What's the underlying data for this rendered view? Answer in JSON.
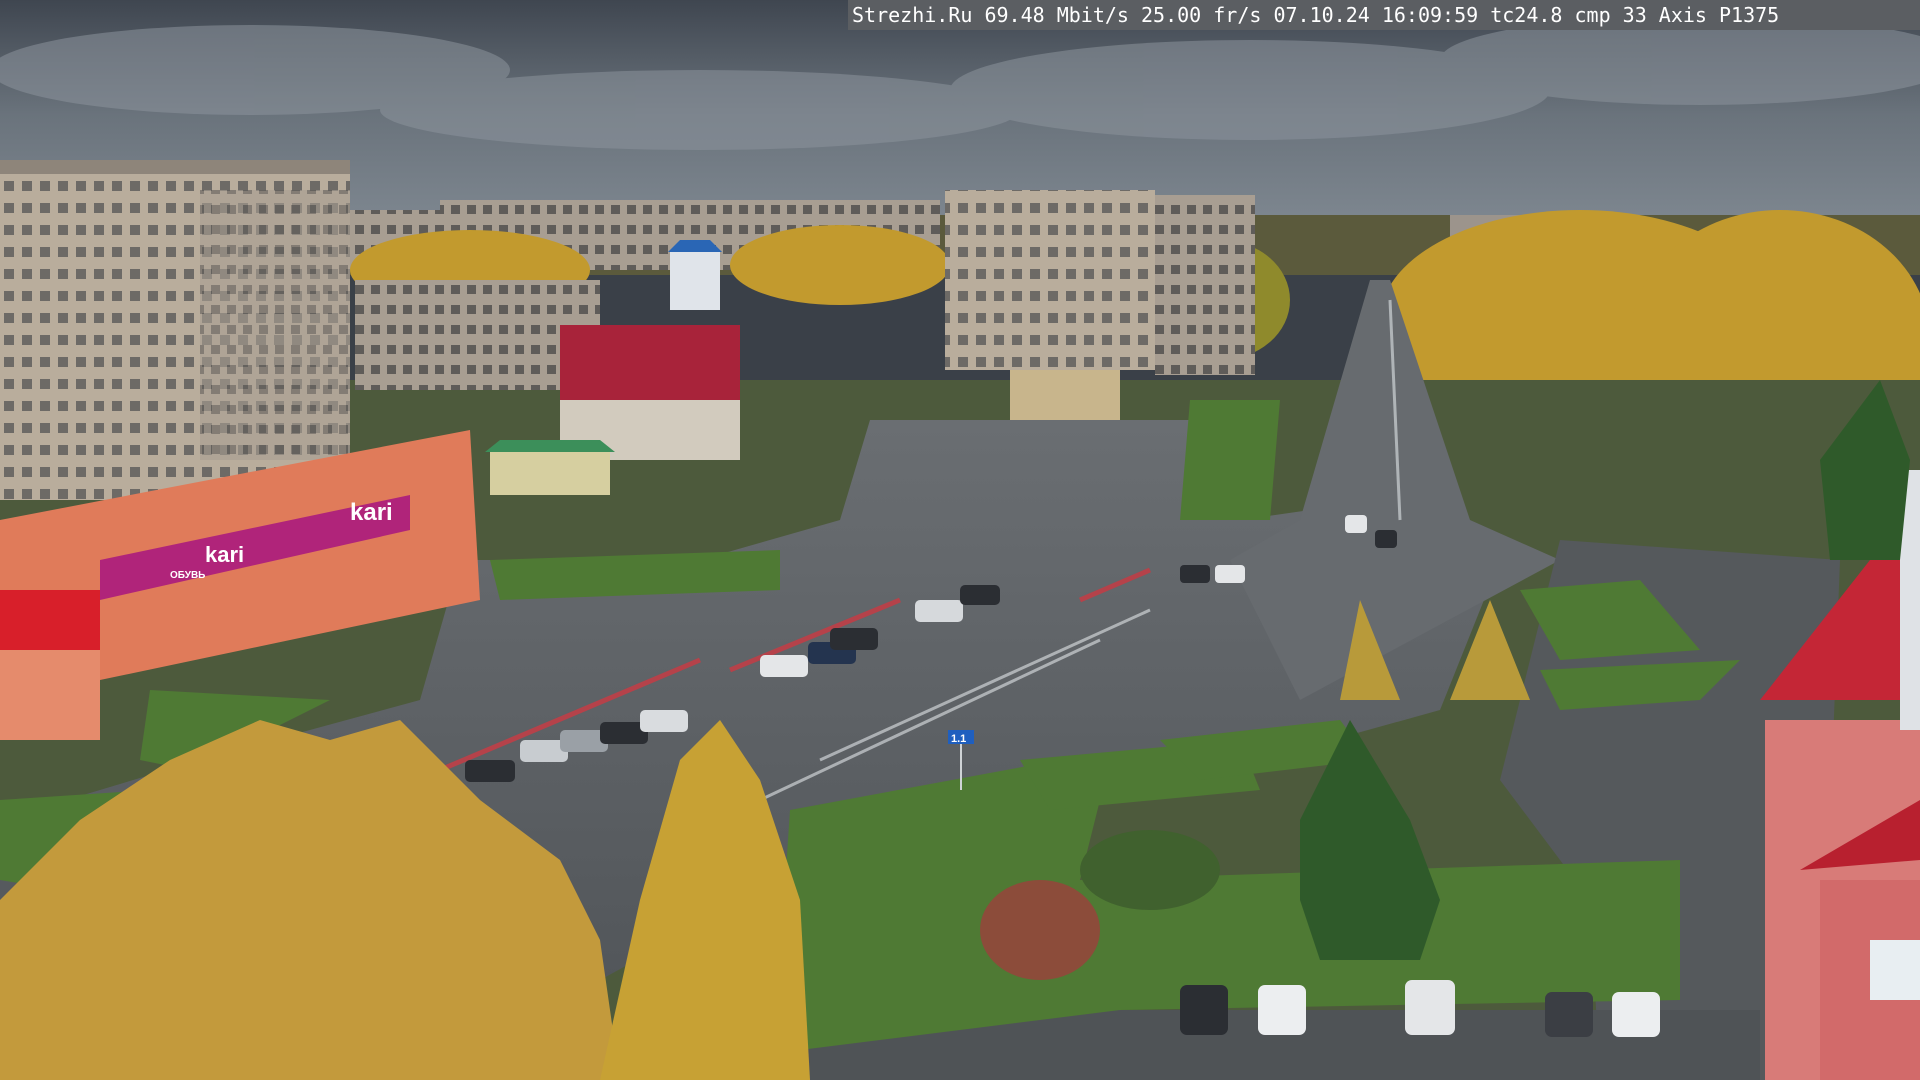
{
  "osd": {
    "site": "Strezhi.Ru",
    "bitrate": "69.48 Mbit/s",
    "framerate": "25.00 fr/s",
    "date": "07.10.24",
    "time": "16:09:59",
    "tc": "tc24.8",
    "cmp": "cmp 33",
    "camera_model": "Axis P1375"
  },
  "signs": {
    "store_brand": "kari",
    "store_brand_lower": "kari",
    "store_caption": "ОБУВЬ",
    "street_sign": "1.1"
  },
  "colors": {
    "sky": "#5c6670",
    "asphalt": "#5a5e62",
    "kari_magenta": "#b0247a",
    "roof_red": "#b31f33",
    "foliage": "#c8a23a",
    "grass": "#4f7a34"
  }
}
